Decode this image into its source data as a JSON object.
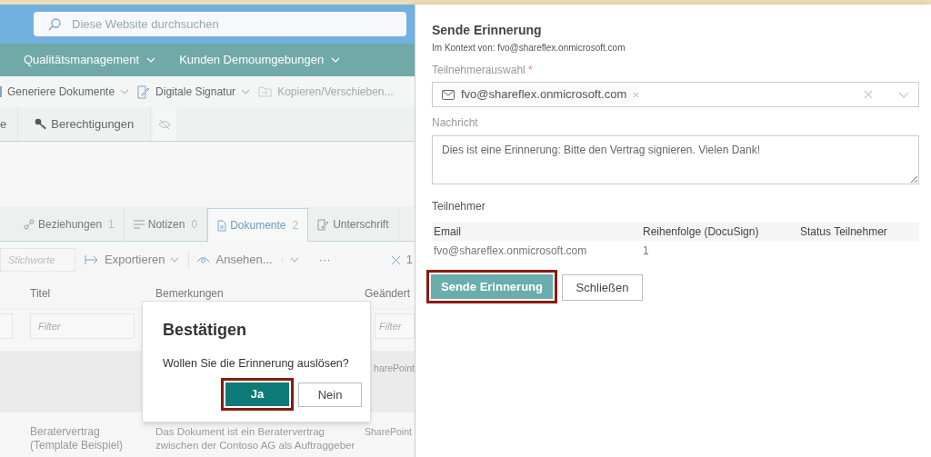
{
  "search": {
    "placeholder": "Diese Website durchsuchen"
  },
  "nav": [
    {
      "label": "Qualitätsmanagement"
    },
    {
      "label": "Kunden Demoumgebungen"
    }
  ],
  "toolbar": [
    {
      "label": "Generiere Dokumente",
      "kind": "plain",
      "disabled": false
    },
    {
      "label": "Digitale Signatur",
      "kind": "signature",
      "disabled": false
    },
    {
      "label": "Kopieren/Verschieben...",
      "kind": "move",
      "disabled": true
    }
  ],
  "ribbon": [
    {
      "label": "e",
      "kind": "plain"
    },
    {
      "label": "Berechtigungen",
      "kind": "key"
    }
  ],
  "tabs": [
    {
      "label": "Beziehungen",
      "count": "1",
      "kind": "relations",
      "selected": false
    },
    {
      "label": "Notizen",
      "count": "0",
      "kind": "notes",
      "selected": false
    },
    {
      "label": "Dokumente",
      "count": "2",
      "kind": "document",
      "selected": true
    },
    {
      "label": "Unterschrift",
      "kind": "signature",
      "selected": false
    }
  ],
  "list_toolbar": {
    "keyword_placeholder": "Stichworte",
    "export": "Exportieren",
    "view": "Ansehen...",
    "more": "···",
    "selected_count": "1"
  },
  "table": {
    "columns": [
      "Titel",
      "Bemerkungen",
      "Geändert"
    ],
    "filter_placeholders": [
      "Filter",
      "Filter"
    ],
    "rows": [
      {
        "selected": true,
        "column_3": "harePoint"
      },
      {
        "selected": false,
        "title": "Beratervertrag (Template Beispiel)",
        "remarks": "Das Dokument ist ein Beratervertrag zwischen der Contoso AG als Auftraggeber",
        "column_3": "SharePoint"
      }
    ]
  },
  "dialog": {
    "title": "Bestätigen",
    "message": "Wollen Sie die Erinnerung auslösen?",
    "buttons": [
      {
        "label": "Ja",
        "kind": "primary",
        "highlighted": true
      },
      {
        "label": "Nein",
        "kind": "secondary",
        "highlighted": false
      }
    ]
  },
  "panel": {
    "title": "Sende Erinnerung",
    "context": "Im Kontext von: fvo@shareflex.onmicrosoft.com",
    "participant_label": "Teilnehmerauswahl",
    "required_marker": "*",
    "chips": [
      "fvo@shareflex.onmicrosoft.com"
    ],
    "message_label": "Nachricht",
    "message": "Dies ist eine Erinnerung: Bitte den Vertrag signieren. Vielen Dank!",
    "participants_heading": "Teilnehmer",
    "columns": [
      "Email",
      "Reihenfolge (DocuSign)",
      "Status Teilnehmer"
    ],
    "rows": [
      [
        "fvo@shareflex.onmicrosoft.com",
        "1"
      ]
    ],
    "buttons": [
      {
        "label": "Sende Erinnerung",
        "kind": "primary",
        "highlighted": true
      },
      {
        "label": "Schließen",
        "kind": "secondary",
        "highlighted": false
      }
    ]
  }
}
